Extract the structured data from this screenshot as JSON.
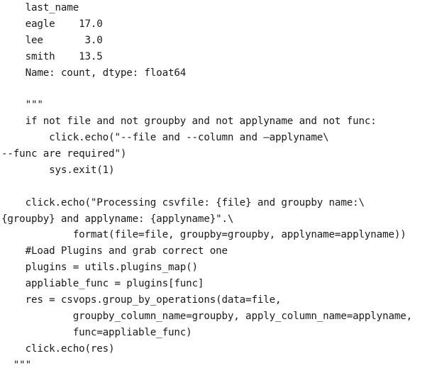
{
  "code": {
    "lines": [
      "    last_name",
      "    eagle    17.0",
      "    lee       3.0",
      "    smith    13.5",
      "    Name: count, dtype: float64",
      "",
      "    \"\"\"",
      "    if not file and not groupby and not applyname and not func:",
      "        click.echo(\"--file and --column and –applyname\\",
      "--func are required\")",
      "        sys.exit(1)",
      "",
      "    click.echo(\"Processing csvfile: {file} and groupby name:\\",
      "{groupby} and applyname: {applyname}\".\\",
      "            format(file=file, groupby=groupby, applyname=applyname))",
      "    #Load Plugins and grab correct one",
      "    plugins = utils.plugins_map()",
      "    appliable_func = plugins[func]",
      "    res = csvops.group_by_operations(data=file,",
      "            groupby_column_name=groupby, apply_column_name=applyname,",
      "            func=appliable_func)",
      "    click.echo(res)",
      "  \"\"\""
    ]
  }
}
